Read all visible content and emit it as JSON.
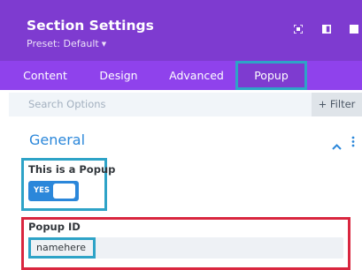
{
  "header": {
    "title": "Section Settings",
    "preset_label": "Preset: Default",
    "icons": [
      "fullscreen-icon",
      "split-view-icon",
      "more-icon"
    ]
  },
  "tabs": [
    {
      "label": "Content",
      "active": false
    },
    {
      "label": "Design",
      "active": false
    },
    {
      "label": "Advanced",
      "active": false
    },
    {
      "label": "Popup",
      "active": true
    }
  ],
  "search": {
    "placeholder": "Search Options",
    "filter_label": "+ Filter"
  },
  "section": {
    "title": "General",
    "collapsed": false
  },
  "fields": {
    "is_popup": {
      "label": "This is a Popup",
      "toggle_text": "YES",
      "value": true
    },
    "popup_id": {
      "label": "Popup ID",
      "value": "namehere"
    }
  },
  "colors": {
    "header_bg": "#7e3bd0",
    "tabs_bg": "#8f42ec",
    "accent_blue": "#2b87da",
    "highlight_cyan": "#2ea3c7",
    "highlight_red": "#d9263f"
  }
}
